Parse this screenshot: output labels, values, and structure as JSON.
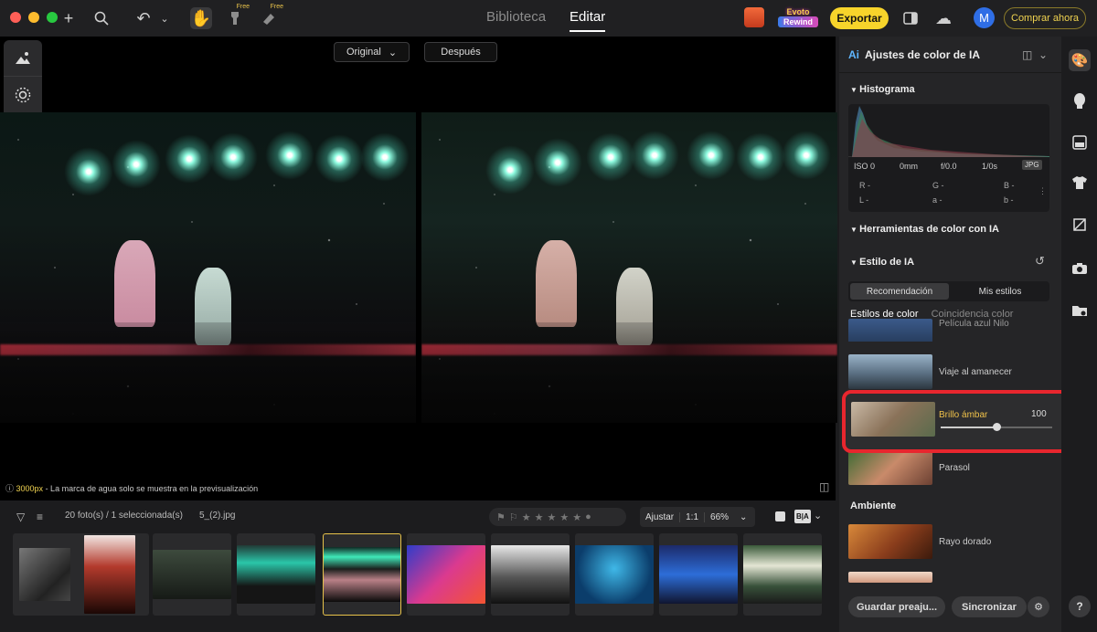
{
  "top": {
    "tabs": [
      {
        "label": "Biblioteca",
        "active": false
      },
      {
        "label": "Editar",
        "active": true
      }
    ],
    "free_label": "Free",
    "rewind_line1": "Evoto",
    "rewind_line2": "Rewind",
    "export_label": "Exportar",
    "avatar_initial": "M",
    "buy_label": "Comprar ahora",
    "icons": [
      "plus-icon",
      "search-icon",
      "undo-icon",
      "chevron-down-icon",
      "hand-icon",
      "brush-icon",
      "eraser-icon",
      "gift-icon",
      "crop-icon",
      "cloud-icon"
    ]
  },
  "canvas": {
    "view_select": "Original",
    "after_label": "Después",
    "watermark_px": "3000px",
    "watermark_text": " - La marca de agua solo se muestra en la previsualización"
  },
  "filmstrip": {
    "count_text": "20 foto(s) / 1 seleccionada(s)",
    "filename": "5_(2).jpg",
    "fit_label": "Ajustar",
    "ratio_label": "1:1",
    "zoom_value": "66%",
    "ba_label": "B|A",
    "thumbs": 10,
    "selected_index": 4
  },
  "panel": {
    "title": "Ajustes de color de IA",
    "histogram_title": "Histograma",
    "exif": {
      "iso": "ISO 0",
      "focal": "0mm",
      "aperture": "f/0.0",
      "shutter": "1/0s",
      "format": "JPG"
    },
    "rgb": {
      "r": "R -",
      "g": "G -",
      "b": "B -",
      "l": "L -",
      "a": "a -",
      "bb": "b -"
    },
    "tools_title": "Herramientas de color con IA",
    "style_title": "Estilo de IA",
    "segments": [
      {
        "label": "Recomendación",
        "active": true
      },
      {
        "label": "Mis estilos",
        "active": false
      }
    ],
    "subtabs": [
      {
        "label": "Estilos de color",
        "active": true
      },
      {
        "label": "Coincidencia color",
        "active": false
      }
    ],
    "styles": [
      {
        "name": "Película azul Nilo"
      },
      {
        "name": "Viaje al amanecer"
      },
      {
        "name": "Parasol"
      }
    ],
    "active_style": {
      "name": "Brillo ámbar",
      "value": "100",
      "level_fraction": 0.5
    },
    "ambient_title": "Ambiente",
    "ambient_styles": [
      {
        "name": "Rayo dorado"
      }
    ],
    "save_preset_label": "Guardar preaju...",
    "sync_label": "Sincronizar",
    "help_label": "?"
  },
  "colors": {
    "accent_yellow": "#f7d42b",
    "highlight_red": "#e8262e",
    "panel_bg": "#252527",
    "avatar_blue": "#2f6ee6"
  }
}
